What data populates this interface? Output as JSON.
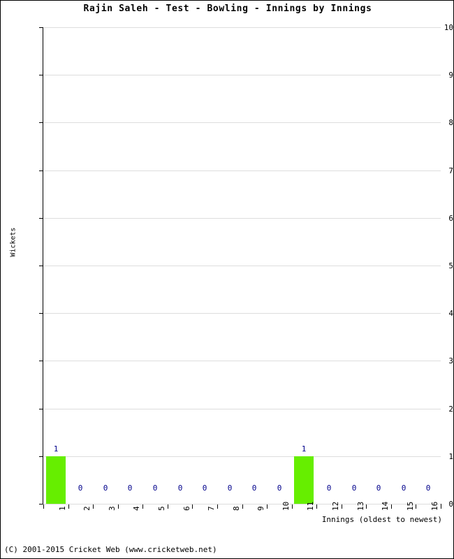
{
  "chart_data": {
    "type": "bar",
    "title": "Rajin Saleh - Test - Bowling - Innings by Innings",
    "xlabel": "Innings (oldest to newest)",
    "ylabel": "Wickets",
    "categories": [
      "1",
      "2",
      "3",
      "4",
      "5",
      "6",
      "7",
      "8",
      "9",
      "10",
      "11",
      "12",
      "13",
      "14",
      "15",
      "16"
    ],
    "values": [
      1,
      0,
      0,
      0,
      0,
      0,
      0,
      0,
      0,
      0,
      1,
      0,
      0,
      0,
      0,
      0
    ],
    "point_labels": [
      "1",
      "0",
      "0",
      "0",
      "0",
      "0",
      "0",
      "0",
      "0",
      "0",
      "1",
      "0",
      "0",
      "0",
      "0",
      "0"
    ],
    "ylim": [
      0,
      10
    ],
    "y_ticks": [
      "0",
      "1",
      "2",
      "3",
      "4",
      "5",
      "6",
      "7",
      "8",
      "9",
      "10"
    ],
    "grid": true,
    "legend": null,
    "bar_color": "#66ee00",
    "label_color": "#00008b",
    "gridline_color": "#dddddd",
    "axis_color": "#000000"
  },
  "footer": {
    "credit": "(C) 2001-2015 Cricket Web (www.cricketweb.net)"
  }
}
